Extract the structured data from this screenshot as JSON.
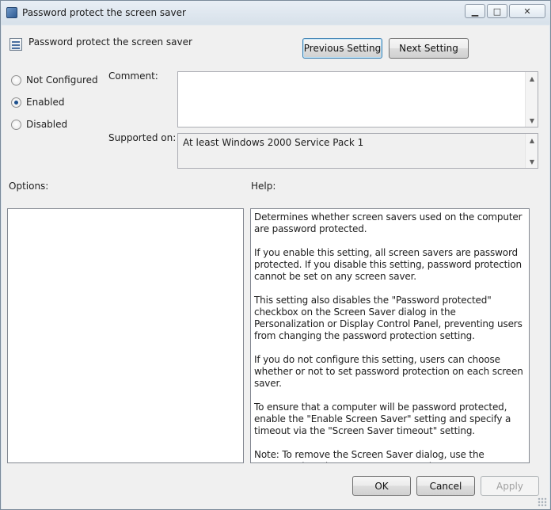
{
  "window": {
    "title": "Password protect the screen saver",
    "controls": {
      "minimize_icon": "minimize-icon",
      "maximize_icon": "maximize-icon",
      "close_icon": "close-icon"
    }
  },
  "header": {
    "setting_name": "Password protect the screen saver",
    "previous_label": "Previous Setting",
    "next_label": "Next Setting"
  },
  "state": {
    "options": [
      {
        "label": "Not Configured",
        "checked": false
      },
      {
        "label": "Enabled",
        "checked": true
      },
      {
        "label": "Disabled",
        "checked": false
      }
    ]
  },
  "comment": {
    "label": "Comment:",
    "value": ""
  },
  "supported": {
    "label": "Supported on:",
    "value": "At least Windows 2000 Service Pack 1"
  },
  "options_pane": {
    "label": "Options:"
  },
  "help_pane": {
    "label": "Help:",
    "paragraphs": [
      "Determines whether screen savers used on the computer are password protected.",
      "If you enable this setting, all screen savers are password protected. If you disable this setting, password protection cannot be set on any screen saver.",
      "This setting also disables the \"Password protected\" checkbox on the Screen Saver dialog in the Personalization or Display Control Panel, preventing users from changing the password protection setting.",
      "If you do not configure this setting, users can choose whether or not to set password protection on each screen saver.",
      "To ensure that a computer will be password protected, enable the \"Enable Screen Saver\" setting and specify a timeout via the \"Screen Saver timeout\" setting.",
      "Note: To remove the Screen Saver dialog, use the \"Prevent changing Screen Saver\" setting."
    ]
  },
  "footer": {
    "ok_label": "OK",
    "cancel_label": "Cancel",
    "apply_label": "Apply"
  },
  "colors": {
    "focus_border": "#3c7fb1",
    "radio_dot": "#1b4f8c"
  }
}
